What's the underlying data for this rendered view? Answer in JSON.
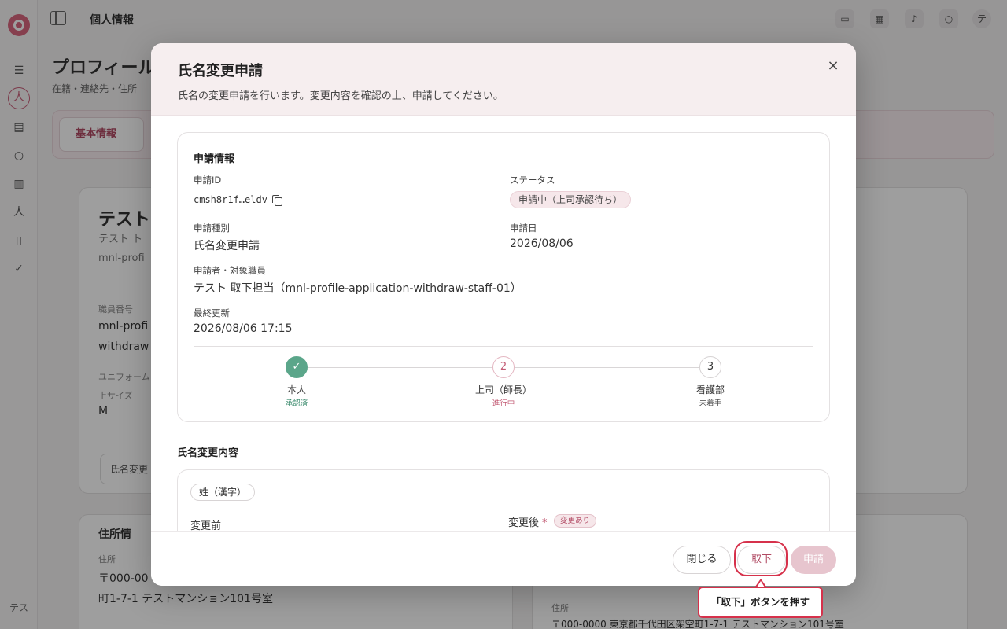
{
  "background": {
    "breadcrumb": "個人情報",
    "avatar_initials": "テス",
    "topbar_avatar": "テ",
    "page_title": "プロフィール",
    "page_subtitle": "在籍・連絡先・住所",
    "tab_basic": "基本情報",
    "profile_name": "テスト",
    "profile_kana": "テスト ト",
    "profile_id": "mnl-profi",
    "staff_no_label": "職員番号",
    "staff_no_value_1": "mnl-profi",
    "staff_no_value_2": "withdraw",
    "uniform_label": "ユニフォーム",
    "uniform_sub_label": "上サイズ",
    "uniform_value": "M",
    "name_change_button": "氏名変更",
    "address_section": "住所情",
    "address_label": "住所",
    "address_postal": "〒000-00",
    "address_value": "町1-7-1 テストマンション101号室",
    "right_address_label": "住所",
    "right_address_value": "〒000-0000 東京都千代田区架空町1-7-1 テストマンション101号室"
  },
  "modal": {
    "title": "氏名変更申請",
    "description": "氏名の変更申請を行います。変更内容を確認の上、申請してください。",
    "close_label": "×",
    "info": {
      "section_title": "申請情報",
      "id_label": "申請ID",
      "id_value": "cmsh8r1f…eldv",
      "status_label": "ステータス",
      "status_value": "申請中（上司承認待ち）",
      "type_label": "申請種別",
      "type_value": "氏名変更申請",
      "date_label": "申請日",
      "date_value": "2026/08/06",
      "applicant_label": "申請者・対象職員",
      "applicant_value": "テスト 取下担当（mnl-profile-application-withdraw-staff-01）",
      "updated_label": "最終更新",
      "updated_value": "2026/08/06 17:15"
    },
    "steps": [
      {
        "mark": "✓",
        "name": "本人",
        "state": "承認済",
        "state_color": "#3f8d70"
      },
      {
        "mark": "2",
        "name": "上司（師長）",
        "state": "進行中",
        "state_color": "#c25a73"
      },
      {
        "mark": "3",
        "name": "看護部",
        "state": "未着手",
        "state_color": "#444444"
      }
    ],
    "change": {
      "section_title": "氏名変更内容",
      "field_name": "姓（漢字）",
      "before_label": "変更前",
      "after_label": "変更後",
      "required_mark": "*",
      "changed_badge": "変更あり"
    },
    "footer": {
      "close_button": "閉じる",
      "withdraw_button": "取下",
      "apply_button": "申請"
    }
  },
  "callout": {
    "text": "「取下」ボタンを押す"
  },
  "colors": {
    "accent": "#c25a73",
    "success": "#5ba68a",
    "highlight": "#d6314b"
  }
}
